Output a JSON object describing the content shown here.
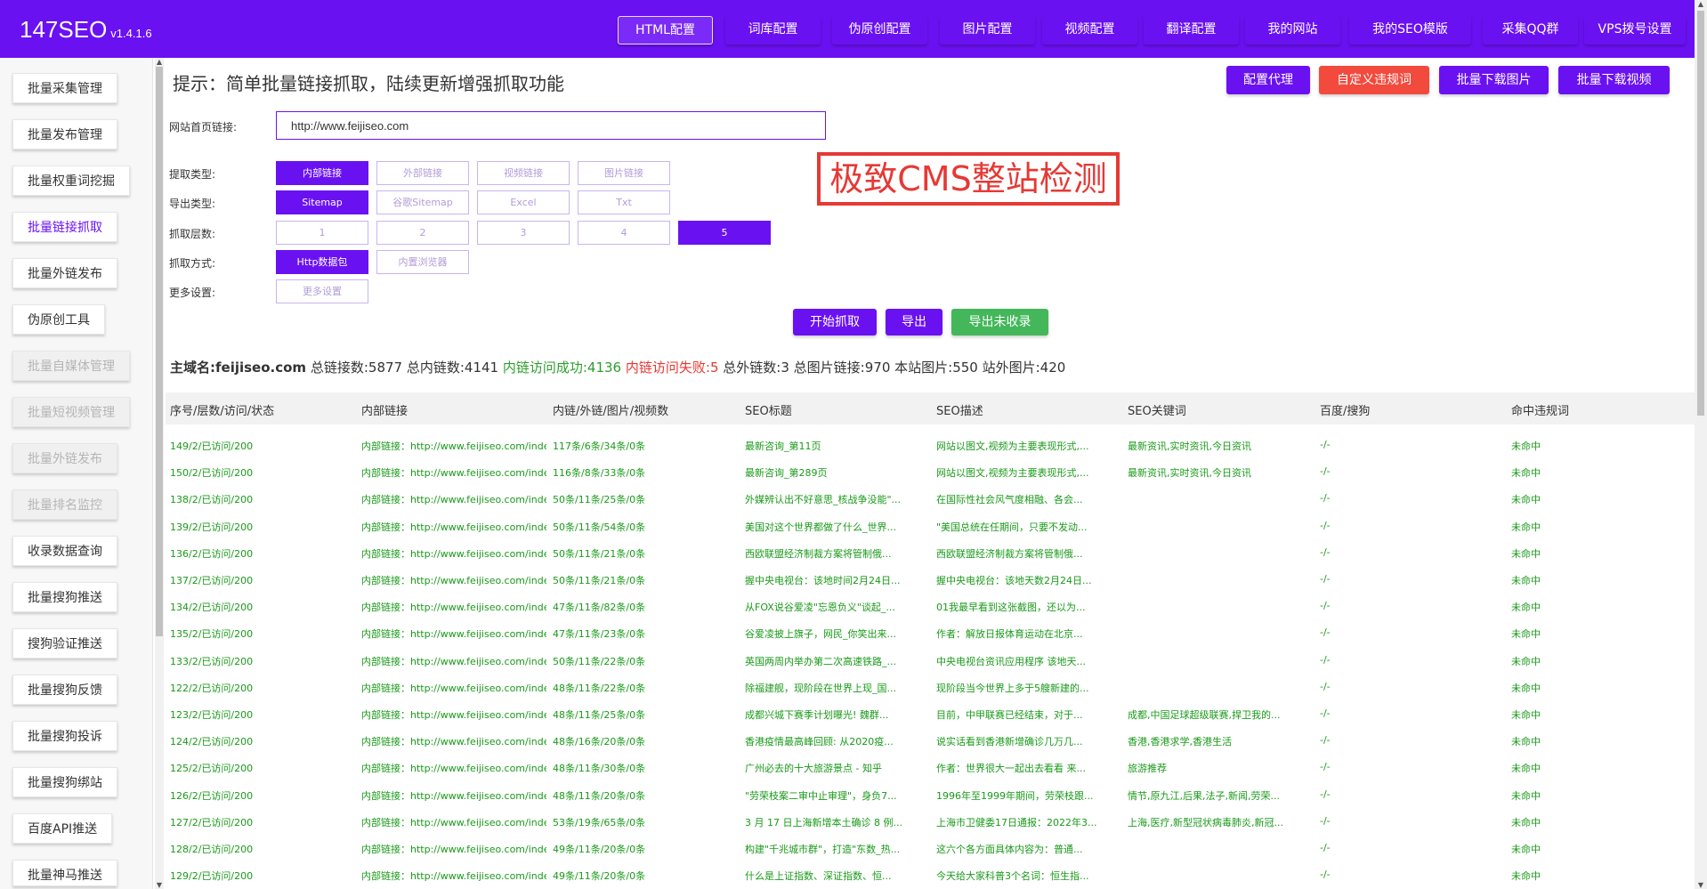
{
  "app": {
    "brand": "147SEO",
    "version": "v1.4.1.6"
  },
  "nav": {
    "items": [
      {
        "label": "HTML配置"
      },
      {
        "label": "词库配置"
      },
      {
        "label": "伪原创配置"
      },
      {
        "label": "图片配置"
      },
      {
        "label": "视频配置"
      },
      {
        "label": "翻译配置"
      },
      {
        "label": "我的网站"
      },
      {
        "label": "我的SEO模版"
      },
      {
        "label": "采集QQ群"
      },
      {
        "label": "VPS拨号设置"
      }
    ]
  },
  "sidebar": {
    "items": [
      {
        "label": "批量采集管理"
      },
      {
        "label": "批量发布管理"
      },
      {
        "label": "批量权重词挖掘"
      },
      {
        "label": "批量链接抓取"
      },
      {
        "label": "批量外链发布"
      },
      {
        "label": "伪原创工具"
      },
      {
        "label": "批量自媒体管理"
      },
      {
        "label": "批量短视频管理"
      },
      {
        "label": "批量外链发布"
      },
      {
        "label": "批量排名监控"
      },
      {
        "label": "收录数据查询"
      },
      {
        "label": "批量搜狗推送"
      },
      {
        "label": "搜狗验证推送"
      },
      {
        "label": "批量搜狗反馈"
      },
      {
        "label": "批量搜狗投诉"
      },
      {
        "label": "批量搜狗绑站"
      },
      {
        "label": "百度API推送"
      },
      {
        "label": "批量神马推送"
      }
    ]
  },
  "hint": "提示：简单批量链接抓取，陆续更新增强抓取功能",
  "toolbar": {
    "proxy": "配置代理",
    "custom_words": "自定义违规词",
    "download_images": "批量下载图片",
    "download_videos": "批量下载视频"
  },
  "form": {
    "url_label": "网站首页链接:",
    "url_value": "http://www.feijiseo.com",
    "extract_type_label": "提取类型:",
    "extract_types": [
      "内部链接",
      "外部链接",
      "视频链接",
      "图片链接"
    ],
    "export_type_label": "导出类型:",
    "export_types": [
      "Sitemap",
      "谷歌Sitemap",
      "Excel",
      "Txt"
    ],
    "depth_label": "抓取层数:",
    "depths": [
      "1",
      "2",
      "3",
      "4",
      "5"
    ],
    "method_label": "抓取方式:",
    "methods": [
      "Http数据包",
      "内置浏览器"
    ],
    "more_label": "更多设置:",
    "more_button": "更多设置"
  },
  "banner": "极致CMS整站检测",
  "actions": {
    "start": "开始抓取",
    "export": "导出",
    "export_unindexed": "导出未收录"
  },
  "summary": {
    "domain_label": "主域名:",
    "domain": "feijiseo.com",
    "total_links": "总链接数:5877",
    "internal_links": "总内链数:4141",
    "success": "内链访问成功:4136",
    "failed": "内链访问失败:5",
    "external": "总外链数:3",
    "images": "总图片链接:970",
    "site_images": "本站图片:550",
    "offsite_images": "站外图片:420"
  },
  "table": {
    "headers": [
      "序号/层数/访问/状态",
      "内部链接",
      "内链/外链/图片/视频数",
      "SEO标题",
      "SEO描述",
      "SEO关键词",
      "百度/搜狗",
      "命中违规词"
    ],
    "rows": [
      [
        "149/2/已访问/200",
        "内部链接：http://www.feijiseo.com/index",
        "117条/6条/34条/0条",
        "最新咨询_第11页",
        "网站以图文,视频为主要表现形式,...",
        "最新资讯,实时资讯,今日资讯",
        "-/-",
        "未命中"
      ],
      [
        "150/2/已访问/200",
        "内部链接：http://www.feijiseo.com/index",
        "116条/8条/33条/0条",
        "最新咨询_第289页",
        "网站以图文,视频为主要表现形式,...",
        "最新资讯,实时资讯,今日资讯",
        "-/-",
        "未命中"
      ],
      [
        "138/2/已访问/200",
        "内部链接：http://www.feijiseo.com/index",
        "50条/11条/25条/0条",
        "外媒辨认出不好意思_核战争没能\"...",
        "在国际性社会风气度相融、各会...",
        "",
        "-/-",
        "未命中"
      ],
      [
        "139/2/已访问/200",
        "内部链接：http://www.feijiseo.com/index",
        "50条/11条/54条/0条",
        "美国对这个世界都做了什么_世界...",
        "\"美国总统在任期间，只要不发动...",
        "",
        "-/-",
        "未命中"
      ],
      [
        "136/2/已访问/200",
        "内部链接：http://www.feijiseo.com/index",
        "50条/11条/21条/0条",
        "西欧联盟经济制裁方案将管制俄...",
        "西欧联盟经济制裁方案将管制俄...",
        "",
        "-/-",
        "未命中"
      ],
      [
        "137/2/已访问/200",
        "内部链接：http://www.feijiseo.com/index",
        "50条/11条/21条/0条",
        "握中央电视台：该地时间2月24日...",
        "握中央电视台：该地天数2月24日...",
        "",
        "-/-",
        "未命中"
      ],
      [
        "134/2/已访问/200",
        "内部链接：http://www.feijiseo.com/index",
        "47条/11条/82条/0条",
        "从FOX说谷爱凌\"忘恩负义\"谈起_...",
        "01我最早看到这张截图，还以为...",
        "",
        "-/-",
        "未命中"
      ],
      [
        "135/2/已访问/200",
        "内部链接：http://www.feijiseo.com/index",
        "47条/11条/23条/0条",
        "谷爱凌披上旗子，网民_你笑出来...",
        "作者：解放日报体育运动在北京...",
        "",
        "-/-",
        "未命中"
      ],
      [
        "133/2/已访问/200",
        "内部链接：http://www.feijiseo.com/index",
        "50条/11条/22条/0条",
        "英国两周内举办第二次高速铁路_...",
        "中央电视台资讯应用程序 该地天...",
        "",
        "-/-",
        "未命中"
      ],
      [
        "122/2/已访问/200",
        "内部链接：http://www.feijiseo.com/index",
        "48条/11条/22条/0条",
        "除福建舰，现阶段在世界上现_国...",
        "现阶段当今世界上多于5艘新建的...",
        "",
        "-/-",
        "未命中"
      ],
      [
        "123/2/已访问/200",
        "内部链接：http://www.feijiseo.com/index",
        "48条/11条/25条/0条",
        "成都兴城下赛季计划曝光! 魏群...",
        "目前，中甲联赛已经结束，对于...",
        "成都,中国足球超级联赛,捍卫我的...",
        "-/-",
        "未命中"
      ],
      [
        "124/2/已访问/200",
        "内部链接：http://www.feijiseo.com/index",
        "48条/16条/20条/0条",
        "香港疫情最高峰回顾: 从2020疫...",
        "说实话看到香港新增确诊几万几...",
        "香港,香港求学,香港生活",
        "-/-",
        "未命中"
      ],
      [
        "125/2/已访问/200",
        "内部链接：http://www.feijiseo.com/index",
        "48条/11条/30条/0条",
        "广州必去的十大旅游景点 - 知乎",
        "作者：世界很大一起出去看看 来...",
        "旅游推荐",
        "-/-",
        "未命中"
      ],
      [
        "126/2/已访问/200",
        "内部链接：http://www.feijiseo.com/index",
        "48条/11条/20条/0条",
        "\"劳荣枝案二审中止审理\"，身负7...",
        "1996年至1999年期间，劳荣枝跟...",
        "情节,原九江,后果,法子,新闻,劳荣...",
        "-/-",
        "未命中"
      ],
      [
        "127/2/已访问/200",
        "内部链接：http://www.feijiseo.com/index",
        "53条/19条/65条/0条",
        "3 月 17 日上海新增本土确诊 8 例...",
        "上海市卫健委17日通报：2022年3...",
        "上海,医疗,新型冠状病毒肺炎,新冠...",
        "-/-",
        "未命中"
      ],
      [
        "128/2/已访问/200",
        "内部链接：http://www.feijiseo.com/index",
        "49条/11条/20条/0条",
        "构建\"千兆城市群\"，打造\"东数_热...",
        "这六个各方面具体内容为：普通...",
        "",
        "-/-",
        "未命中"
      ],
      [
        "129/2/已访问/200",
        "内部链接：http://www.feijiseo.com/index",
        "49条/11条/20条/0条",
        "什么是上证指数、深证指数、恒...",
        "今天给大家科普3个名词：恒生指...",
        "",
        "-/-",
        "未命中"
      ]
    ]
  },
  "colors": {
    "primary": "#6a11f2",
    "danger": "#f24a3d",
    "success": "#43b75a",
    "row_text": "#1a9a1a"
  }
}
